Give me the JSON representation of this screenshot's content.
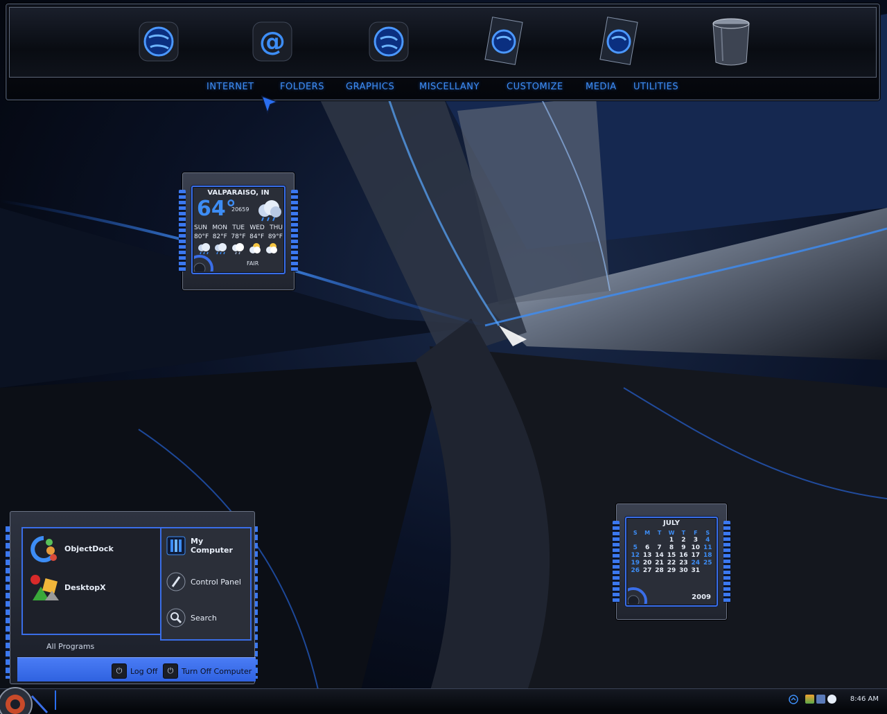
{
  "dock": {
    "icons": [
      {
        "name": "internet-globe-icon"
      },
      {
        "name": "email-at-icon"
      },
      {
        "name": "globe-icon"
      },
      {
        "name": "globe-document-icon"
      },
      {
        "name": "globe-document-icon-2"
      },
      {
        "name": "recycle-bin-icon"
      }
    ],
    "nav": [
      "INTERNET",
      "FOLDERS",
      "GRAPHICS",
      "MISCELLANY",
      "CUSTOMIZE",
      "MEDIA",
      "UTILITIES"
    ]
  },
  "weather": {
    "city": "VALPARAISO, IN",
    "temp": "64°",
    "zip": "20659",
    "days": [
      "SUN",
      "MON",
      "TUE",
      "WED",
      "THU"
    ],
    "highs": [
      "80°F",
      "82°F",
      "78°F",
      "84°F",
      "89°F"
    ],
    "condition": "FAIR"
  },
  "calendar": {
    "month": "JULY",
    "weekdays": [
      "S",
      "M",
      "T",
      "W",
      "T",
      "F",
      "S"
    ],
    "weeks": [
      [
        "",
        "",
        "",
        "1",
        "2",
        "3",
        "4"
      ],
      [
        "5",
        "6",
        "7",
        "8",
        "9",
        "10",
        "11"
      ],
      [
        "12",
        "13",
        "14",
        "15",
        "16",
        "17",
        "18"
      ],
      [
        "19",
        "20",
        "21",
        "22",
        "23",
        "24",
        "25"
      ],
      [
        "26",
        "27",
        "28",
        "29",
        "30",
        "31",
        ""
      ]
    ],
    "year": "2009"
  },
  "startmenu": {
    "pinned": [
      {
        "label": "ObjectDock"
      },
      {
        "label": "DesktopX"
      }
    ],
    "places": [
      {
        "label": "My\nComputer"
      },
      {
        "label": "Control Panel"
      },
      {
        "label": "Search"
      }
    ],
    "all_programs": "All Programs",
    "log_off": "Log Off",
    "turn_off": "Turn Off Computer"
  },
  "taskbar": {
    "clock": "8:46 AM"
  },
  "colors": {
    "accent": "#3d8df5",
    "frame_border": "#3a6ee8"
  }
}
